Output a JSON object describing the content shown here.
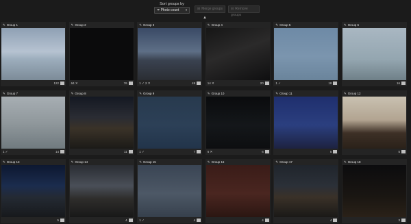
{
  "toolbar": {
    "sort_label": "Sort groups by",
    "sort_value": "Photo count",
    "sort_icon": "sort-icon",
    "merge_label": "Merge groups",
    "remove_label": "Remove groups",
    "merge_icon": "merge-icon",
    "remove_icon": "remove-icon",
    "collapse_icon": "chevron-up-icon"
  },
  "groups": [
    {
      "name": "Group 1",
      "left": "",
      "count": "122"
    },
    {
      "name": "Group 2",
      "left": "64 ✕",
      "count": "76"
    },
    {
      "name": "Group 3",
      "left": "1 ✓  2 ✕",
      "count": "49"
    },
    {
      "name": "Group 4",
      "left": "14 ✕",
      "count": "20"
    },
    {
      "name": "Group 5",
      "left": "1 ✓",
      "count": "18"
    },
    {
      "name": "Group 6",
      "left": "",
      "count": "16"
    },
    {
      "name": "Group 7",
      "left": "1 ✓",
      "count": "14"
    },
    {
      "name": "Group 8",
      "left": "",
      "count": "11"
    },
    {
      "name": "Group 9",
      "left": "1 ✓",
      "count": "7"
    },
    {
      "name": "Group 10",
      "left": "6 ✕",
      "count": "6"
    },
    {
      "name": "Group 11",
      "left": "",
      "count": "5"
    },
    {
      "name": "Group 12",
      "left": "",
      "count": "5"
    },
    {
      "name": "Group 13",
      "left": "",
      "count": "5"
    },
    {
      "name": "Group 14",
      "left": "",
      "count": "4"
    },
    {
      "name": "Group 15",
      "left": "1 ✓",
      "count": "4"
    },
    {
      "name": "Group 16",
      "left": "",
      "count": "4"
    },
    {
      "name": "Group 17",
      "left": "",
      "count": "4"
    },
    {
      "name": "Group 18",
      "left": "",
      "count": "3"
    }
  ]
}
